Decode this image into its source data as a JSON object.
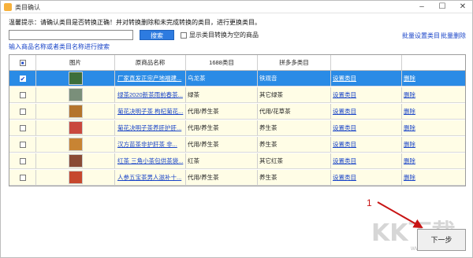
{
  "window": {
    "title": "类目确认"
  },
  "hint": "温馨提示：请确认类目是否转换正确！并对转换删除和未完成转换的类目，进行更换类目。",
  "search": {
    "placeholder": "",
    "value": "",
    "button": "搜索"
  },
  "checkbox_label": "显示类目转换为空的商品",
  "batch_set": "批量设置类目",
  "batch_delete": "批量删除",
  "subhint": "输入商品名称或者类目名称进行搜索",
  "table": {
    "headers": [
      "",
      "图片",
      "原商品名称",
      "1688类目",
      "拼多多类目",
      "",
      ""
    ],
    "rows": [
      {
        "checked": true,
        "selected": true,
        "name": "厂家直发正宗产地福建...",
        "cat1688": "乌龙茶",
        "catpdd": "铁观音",
        "action": "设置类目",
        "del": "删除",
        "thumb": "#3d6e3b"
      },
      {
        "checked": false,
        "selected": false,
        "name": "绿茶2020新茶雨前春茶...",
        "cat1688": "绿茶",
        "catpdd": "其它绿茶",
        "action": "设置类目",
        "del": "删除",
        "thumb": "#7a8f7a"
      },
      {
        "checked": false,
        "selected": false,
        "name": "菊花决明子茶 枸杞菊花...",
        "cat1688": "代用/养生茶",
        "catpdd": "代用/花草茶",
        "action": "设置类目",
        "del": "删除",
        "thumb": "#b4742c"
      },
      {
        "checked": false,
        "selected": false,
        "name": "菊花决明子茶养肝护肝...",
        "cat1688": "代用/养生茶",
        "catpdd": "养生茶",
        "action": "设置类目",
        "del": "删除",
        "thumb": "#c9483d"
      },
      {
        "checked": false,
        "selected": false,
        "name": "汉方苗茶非护肝茶 非...",
        "cat1688": "代用/养生茶",
        "catpdd": "养生茶",
        "action": "设置类目",
        "del": "删除",
        "thumb": "#c88433"
      },
      {
        "checked": false,
        "selected": false,
        "name": "红茶 三角小茶包供茶袋...",
        "cat1688": "红茶",
        "catpdd": "其它红茶",
        "action": "设置类目",
        "del": "删除",
        "thumb": "#8a4b35"
      },
      {
        "checked": false,
        "selected": false,
        "name": "人参五宝茶男人滋补十...",
        "cat1688": "代用/养生茶",
        "catpdd": "养生茶",
        "action": "设置类目",
        "del": "删除",
        "thumb": "#c6482d"
      }
    ]
  },
  "next_button": "下一步",
  "annotation": "1",
  "watermark": "KK下载",
  "watermark_sub": "www.kkx.net"
}
